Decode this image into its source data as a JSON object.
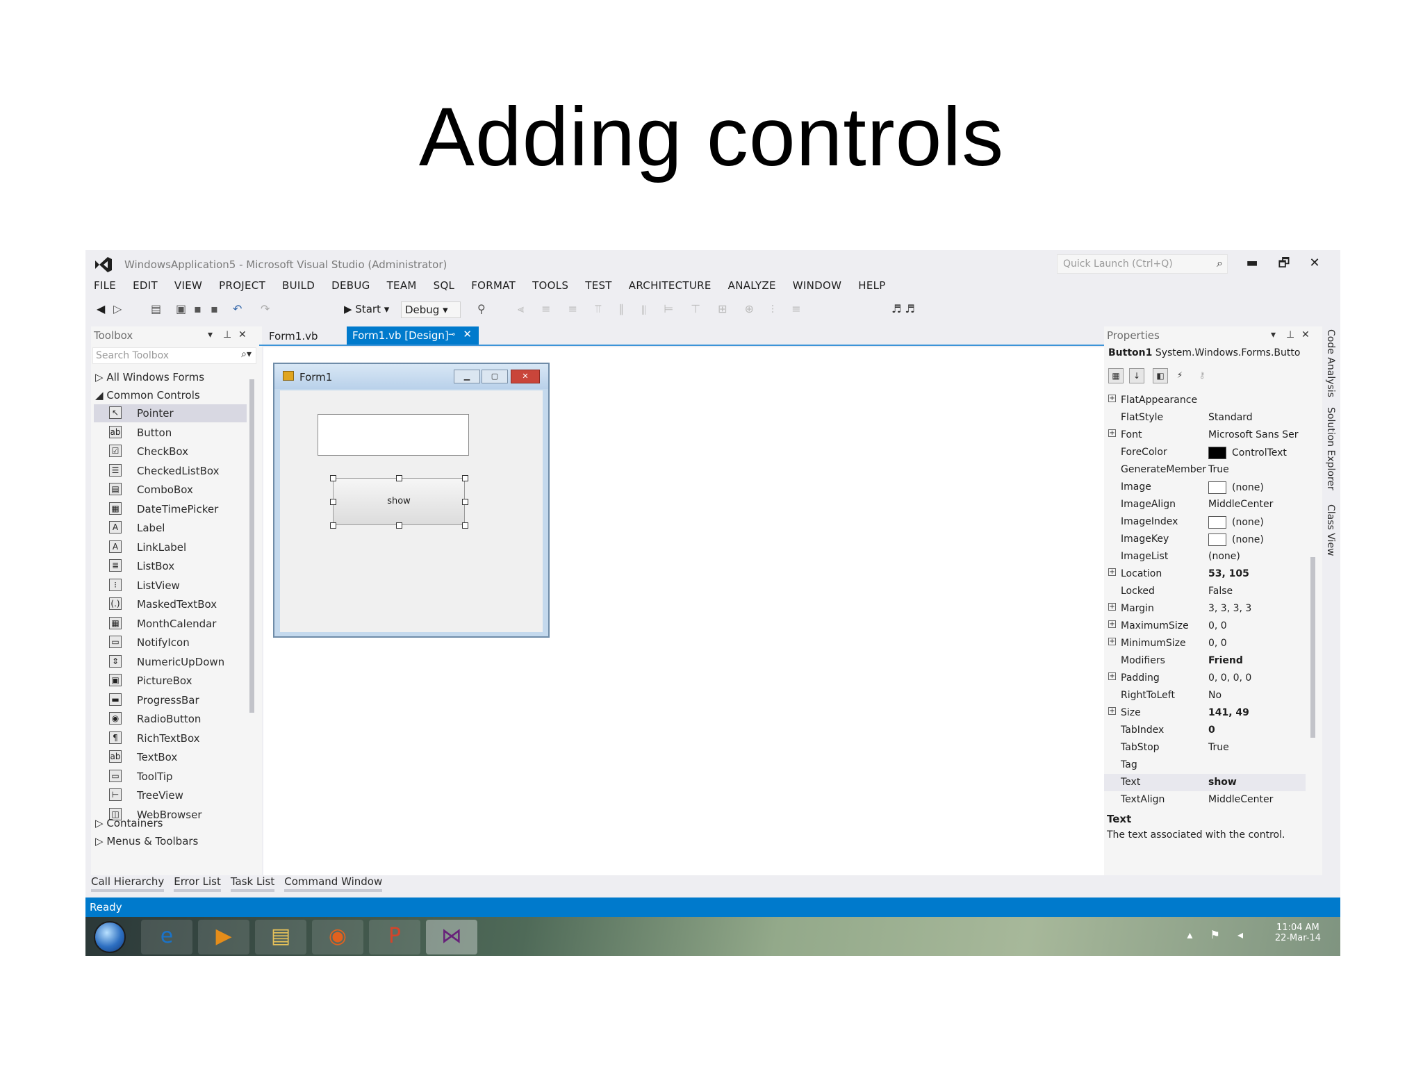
{
  "slide": {
    "title": "Adding controls"
  },
  "window": {
    "title": "WindowsApplication5 - Microsoft Visual Studio (Administrator)",
    "quick_launch_placeholder": "Quick Launch (Ctrl+Q)",
    "minimize": "▬",
    "restore": "🗗",
    "close": "✕"
  },
  "menu": [
    "FILE",
    "EDIT",
    "VIEW",
    "PROJECT",
    "BUILD",
    "DEBUG",
    "TEAM",
    "SQL",
    "FORMAT",
    "TOOLS",
    "TEST",
    "ARCHITECTURE",
    "ANALYZE",
    "WINDOW",
    "HELP"
  ],
  "toolbar": {
    "start_label": "Start",
    "configuration": "Debug"
  },
  "toolbox": {
    "title": "Toolbox",
    "search_placeholder": "Search Toolbox",
    "groups_top": [
      "All Windows Forms",
      "Common Controls"
    ],
    "items": [
      {
        "label": "Pointer",
        "icon": "pointer-icon",
        "glyph": "↖"
      },
      {
        "label": "Button",
        "icon": "button-icon",
        "glyph": "ab"
      },
      {
        "label": "CheckBox",
        "icon": "checkbox-icon",
        "glyph": "☑"
      },
      {
        "label": "CheckedListBox",
        "icon": "checked-listbox-icon",
        "glyph": "☰"
      },
      {
        "label": "ComboBox",
        "icon": "combobox-icon",
        "glyph": "▤"
      },
      {
        "label": "DateTimePicker",
        "icon": "datetimepicker-icon",
        "glyph": "▦"
      },
      {
        "label": "Label",
        "icon": "label-icon",
        "glyph": "A"
      },
      {
        "label": "LinkLabel",
        "icon": "linklabel-icon",
        "glyph": "A"
      },
      {
        "label": "ListBox",
        "icon": "listbox-icon",
        "glyph": "≣"
      },
      {
        "label": "ListView",
        "icon": "listview-icon",
        "glyph": "⁝"
      },
      {
        "label": "MaskedTextBox",
        "icon": "maskedtextbox-icon",
        "glyph": "(.)"
      },
      {
        "label": "MonthCalendar",
        "icon": "monthcalendar-icon",
        "glyph": "▦"
      },
      {
        "label": "NotifyIcon",
        "icon": "notifyicon-icon",
        "glyph": "▭"
      },
      {
        "label": "NumericUpDown",
        "icon": "numericupdown-icon",
        "glyph": "⇕"
      },
      {
        "label": "PictureBox",
        "icon": "picturebox-icon",
        "glyph": "▣"
      },
      {
        "label": "ProgressBar",
        "icon": "progressbar-icon",
        "glyph": "▬"
      },
      {
        "label": "RadioButton",
        "icon": "radiobutton-icon",
        "glyph": "◉"
      },
      {
        "label": "RichTextBox",
        "icon": "richtextbox-icon",
        "glyph": "¶"
      },
      {
        "label": "TextBox",
        "icon": "textbox-icon",
        "glyph": "ab"
      },
      {
        "label": "ToolTip",
        "icon": "tooltip-icon",
        "glyph": "▭"
      },
      {
        "label": "TreeView",
        "icon": "treeview-icon",
        "glyph": "⊢"
      },
      {
        "label": "WebBrowser",
        "icon": "webbrowser-icon",
        "glyph": "◫"
      }
    ],
    "groups_bottom": [
      "Containers",
      "Menus & Toolbars"
    ]
  },
  "tabs": [
    {
      "label": "Form1.vb",
      "active": false
    },
    {
      "label": "Form1.vb [Design]",
      "active": true
    }
  ],
  "designer": {
    "form_title": "Form1",
    "button_text": "show"
  },
  "properties": {
    "title": "Properties",
    "object_name": "Button1",
    "object_type": "System.Windows.Forms.Butto",
    "rows": [
      {
        "name": "FlatAppearance",
        "value": "",
        "expandable": true
      },
      {
        "name": "FlatStyle",
        "value": "Standard"
      },
      {
        "name": "Font",
        "value": "Microsoft Sans Ser",
        "expandable": true
      },
      {
        "name": "ForeColor",
        "value": "ControlText",
        "swatch": "#000000"
      },
      {
        "name": "GenerateMember",
        "value": "True"
      },
      {
        "name": "Image",
        "value": "(none)",
        "swatch": "#ffffff"
      },
      {
        "name": "ImageAlign",
        "value": "MiddleCenter"
      },
      {
        "name": "ImageIndex",
        "value": "(none)",
        "swatch": "#ffffff"
      },
      {
        "name": "ImageKey",
        "value": "(none)",
        "swatch": "#ffffff"
      },
      {
        "name": "ImageList",
        "value": "(none)"
      },
      {
        "name": "Location",
        "value": "53, 105",
        "expandable": true,
        "bold": true
      },
      {
        "name": "Locked",
        "value": "False"
      },
      {
        "name": "Margin",
        "value": "3, 3, 3, 3",
        "expandable": true
      },
      {
        "name": "MaximumSize",
        "value": "0, 0",
        "expandable": true
      },
      {
        "name": "MinimumSize",
        "value": "0, 0",
        "expandable": true
      },
      {
        "name": "Modifiers",
        "value": "Friend",
        "bold": true
      },
      {
        "name": "Padding",
        "value": "0, 0, 0, 0",
        "expandable": true
      },
      {
        "name": "RightToLeft",
        "value": "No"
      },
      {
        "name": "Size",
        "value": "141, 49",
        "expandable": true,
        "bold": true
      },
      {
        "name": "TabIndex",
        "value": "0",
        "bold": true
      },
      {
        "name": "TabStop",
        "value": "True"
      },
      {
        "name": "Tag",
        "value": ""
      },
      {
        "name": "Text",
        "value": "show",
        "bold": true,
        "selected": true
      },
      {
        "name": "TextAlign",
        "value": "MiddleCenter"
      }
    ],
    "description_title": "Text",
    "description_text": "The text associated with the control."
  },
  "side_tabs": [
    "Code Analysis",
    "Solution Explorer",
    "Class View"
  ],
  "bottom_tabs": [
    "Call Hierarchy",
    "Error List",
    "Task List",
    "Command Window"
  ],
  "status": {
    "text": "Ready"
  },
  "taskbar": {
    "apps": [
      {
        "name": "internet-explorer-icon",
        "glyph": "e",
        "color": "#1a73c9"
      },
      {
        "name": "media-player-icon",
        "glyph": "▶",
        "color": "#e58d1a"
      },
      {
        "name": "file-explorer-icon",
        "glyph": "▤",
        "color": "#e8c35a"
      },
      {
        "name": "firefox-icon",
        "glyph": "◉",
        "color": "#e2611e"
      },
      {
        "name": "powerpoint-icon",
        "glyph": "P",
        "color": "#d2452b"
      },
      {
        "name": "visual-studio-icon",
        "glyph": "⋈",
        "color": "#68217a"
      }
    ],
    "time": "11:04 AM",
    "date": "22-Mar-14"
  },
  "colors": {
    "accent": "#007acc",
    "status_bar": "#007acc",
    "form_close": "#c9453a"
  }
}
